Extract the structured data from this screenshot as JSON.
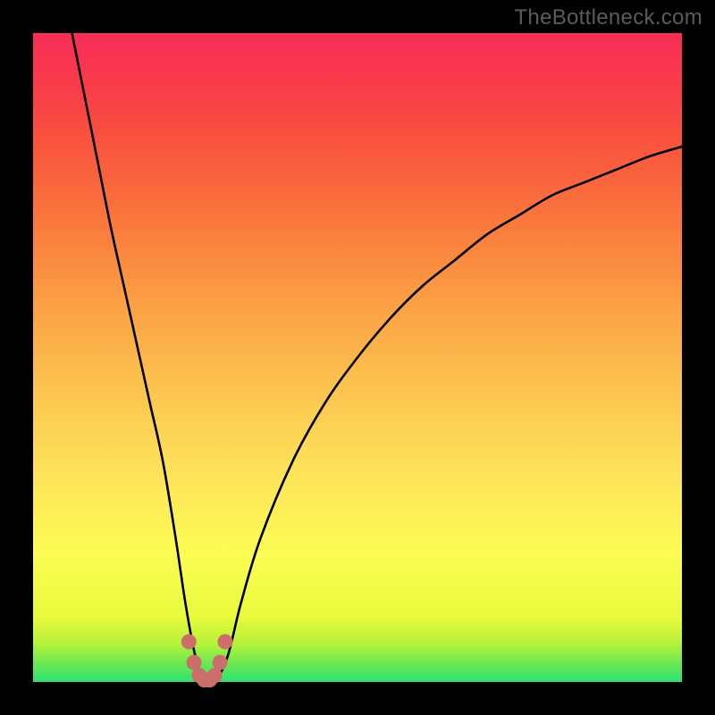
{
  "watermark": "TheBottleneck.com",
  "colors": {
    "page_bg": "#000000",
    "curve_stroke": "#000000",
    "dots_fill": "#cc6f6b",
    "gradient_stops": [
      "#2fe277",
      "#6fe94f",
      "#b7f23a",
      "#e9fb3c",
      "#fcfc55",
      "#fde35a",
      "#fcc44f",
      "#fba144",
      "#fa7b3d",
      "#f9573d",
      "#f83b49",
      "#f72e58"
    ]
  },
  "chart_data": {
    "type": "line",
    "title": "",
    "xlabel": "",
    "ylabel": "",
    "xlim": [
      0,
      100
    ],
    "ylim": [
      0,
      100
    ],
    "series": [
      {
        "name": "bottleneck-curve",
        "x": [
          6,
          8,
          10,
          12,
          14,
          16,
          18,
          20,
          22,
          23.5,
          25,
          26.5,
          28,
          30,
          32,
          35,
          40,
          45,
          50,
          55,
          60,
          65,
          70,
          75,
          80,
          85,
          90,
          95,
          100
        ],
        "values": [
          100,
          90,
          80,
          70,
          61,
          52,
          43,
          34,
          22,
          12,
          4,
          0,
          0,
          4,
          12,
          22,
          34,
          43,
          50,
          56,
          61,
          65,
          69,
          72,
          75,
          77,
          79,
          81,
          82.5
        ]
      }
    ],
    "highlight_dots": {
      "name": "minimum-region",
      "x": [
        24.0,
        24.8,
        25.6,
        26.4,
        27.2,
        28.0,
        28.8,
        29.6
      ],
      "values": [
        6.2,
        3.0,
        1.0,
        0.3,
        0.3,
        1.0,
        3.0,
        6.2
      ]
    }
  }
}
